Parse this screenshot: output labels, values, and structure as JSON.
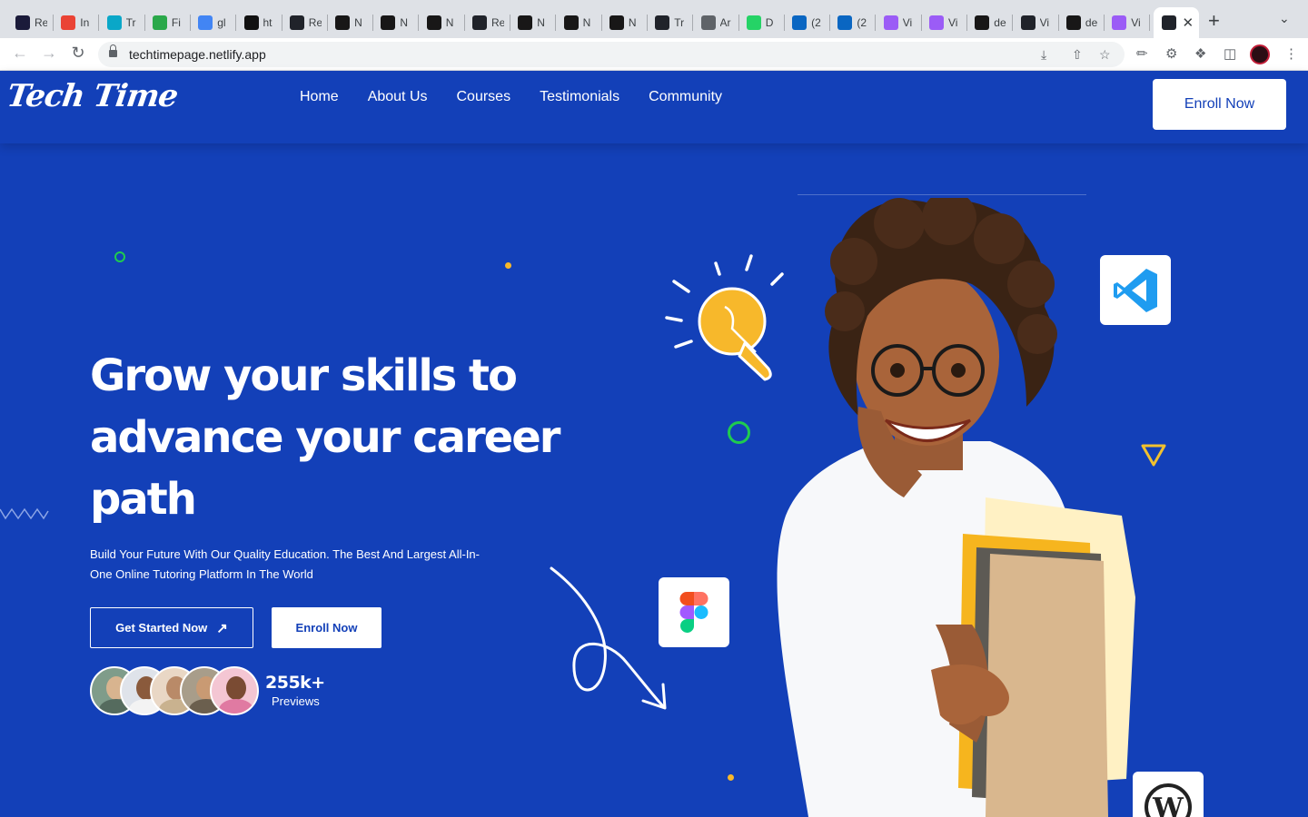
{
  "browser": {
    "tabs": [
      {
        "icon": "rx-icon",
        "label": "Re",
        "color": "#1b1b3a"
      },
      {
        "icon": "gmail-icon",
        "label": "In",
        "color": "#ea4335"
      },
      {
        "icon": "trello-icon",
        "label": "Tr",
        "color": "#0aa7c8"
      },
      {
        "icon": "infinity-icon",
        "label": "Fi",
        "color": "#2aa84a"
      },
      {
        "icon": "docs-icon",
        "label": "gl",
        "color": "#4285f4"
      },
      {
        "icon": "triangle-icon",
        "label": "ht",
        "color": "#111111"
      },
      {
        "icon": "react-icon",
        "label": "Re",
        "color": "#20232a"
      },
      {
        "icon": "github-icon",
        "label": "N",
        "color": "#181717"
      },
      {
        "icon": "github-icon",
        "label": "N",
        "color": "#181717"
      },
      {
        "icon": "github-icon",
        "label": "N",
        "color": "#181717"
      },
      {
        "icon": "react-icon",
        "label": "Re",
        "color": "#20232a"
      },
      {
        "icon": "github-icon",
        "label": "N",
        "color": "#181717"
      },
      {
        "icon": "github-icon",
        "label": "N",
        "color": "#181717"
      },
      {
        "icon": "github-icon",
        "label": "N",
        "color": "#181717"
      },
      {
        "icon": "react-icon",
        "label": "Tr",
        "color": "#20232a"
      },
      {
        "icon": "globe-icon",
        "label": "Ar",
        "color": "#5f6368"
      },
      {
        "icon": "whatsapp-icon",
        "label": "D",
        "color": "#25d366"
      },
      {
        "icon": "linkedin-icon",
        "label": "(2",
        "color": "#0a66c2"
      },
      {
        "icon": "linkedin-icon",
        "label": "(2",
        "color": "#0a66c2"
      },
      {
        "icon": "vite-icon",
        "label": "Vi",
        "color": "#9b5cf6"
      },
      {
        "icon": "vite-icon",
        "label": "Vi",
        "color": "#9b5cf6"
      },
      {
        "icon": "github-icon",
        "label": "de",
        "color": "#181717"
      },
      {
        "icon": "react-icon",
        "label": "Vi",
        "color": "#20232a"
      },
      {
        "icon": "github-icon",
        "label": "de",
        "color": "#181717"
      },
      {
        "icon": "vite-icon",
        "label": "Vi",
        "color": "#9b5cf6"
      }
    ],
    "url": "techtimepage.netlify.app"
  },
  "header": {
    "logo": "Tech Time",
    "nav": [
      "Home",
      "About Us",
      "Courses",
      "Testimonials",
      "Community"
    ],
    "enroll_label": "Enroll Now"
  },
  "hero": {
    "title_lines": [
      "Grow your skills to",
      "advance your career",
      "path"
    ],
    "subtitle": "Build Your Future With Our Quality Education. The Best And Largest All-In-One Online Tutoring Platform In The World",
    "primary_cta": "Get Started Now",
    "secondary_cta": "Enroll Now",
    "stat_value": "255k+",
    "stat_label": "Previews"
  },
  "colors": {
    "brand_blue": "#1340b8",
    "accent_green": "#1fcb4f",
    "accent_yellow": "#f7b82b"
  }
}
